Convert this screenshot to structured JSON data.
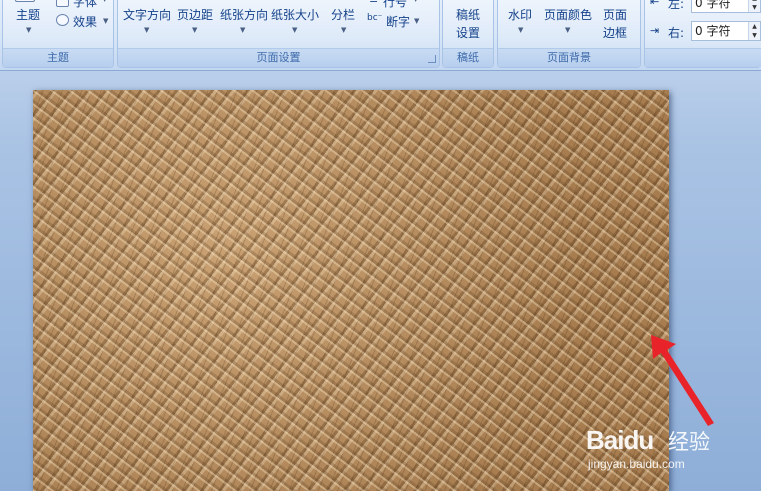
{
  "ribbon": {
    "theme_group": {
      "caption": "主题",
      "theme_button": "主题",
      "font_button": "字体",
      "effect_button": "效果"
    },
    "page_setup_group": {
      "caption": "页面设置",
      "text_direction": "文字方向",
      "margins": "页边距",
      "orientation": "纸张方向",
      "size": "纸张大小",
      "columns": "分栏",
      "line_numbers": "行号",
      "hyphenation": "断字"
    },
    "manuscript_group": {
      "caption": "稿纸",
      "settings_line1": "稿纸",
      "settings_line2": "设置"
    },
    "page_background_group": {
      "caption": "页面背景",
      "watermark": "水印",
      "page_color": "页面颜色",
      "borders_line1": "页面",
      "borders_line2": "边框"
    },
    "indent_group": {
      "left_label": "左:",
      "left_value": "0 字符",
      "right_label": "右:",
      "right_value": "0 字符"
    }
  },
  "document": {
    "page_background": "crumpled paper texture"
  },
  "watermark": {
    "logo": "Baidu",
    "title": "经验",
    "url": "jingyan.baidu.com"
  },
  "colors": {
    "ribbon": "#d6e5f7",
    "workspace": "#8eaed8",
    "arrow": "#e8232a",
    "paper": "#b48a5b"
  }
}
